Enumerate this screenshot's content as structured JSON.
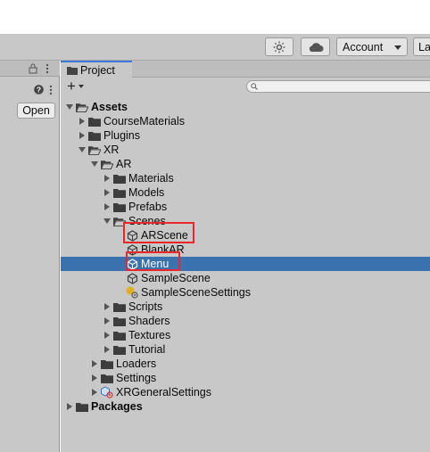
{
  "toolbar": {
    "sun_icon": "lighting-icon",
    "cloud_icon": "cloud-icon",
    "account_label": "Account",
    "layers_label": "La"
  },
  "left_panel": {
    "open_label": "Open"
  },
  "project": {
    "tab_label": "Project",
    "add_label": "+",
    "search_placeholder": ""
  },
  "tree": [
    {
      "label": "Assets",
      "bold": true,
      "expanded": true,
      "icon": "folder-open-icon"
    },
    {
      "label": "CourseMaterials",
      "icon": "folder-icon"
    },
    {
      "label": "Plugins",
      "icon": "folder-icon"
    },
    {
      "label": "XR",
      "expanded": true,
      "icon": "folder-open-icon"
    },
    {
      "label": "AR",
      "expanded": true,
      "icon": "folder-open-icon"
    },
    {
      "label": "Materials",
      "icon": "folder-icon"
    },
    {
      "label": "Models",
      "icon": "folder-icon"
    },
    {
      "label": "Prefabs",
      "icon": "folder-icon"
    },
    {
      "label": "Scenes",
      "expanded": true,
      "icon": "folder-open-icon"
    },
    {
      "label": "ARScene",
      "icon": "unity-scene-icon"
    },
    {
      "label": "BlankAR",
      "icon": "unity-scene-icon"
    },
    {
      "label": "Menu",
      "icon": "unity-scene-icon",
      "selected": true
    },
    {
      "label": "SampleScene",
      "icon": "unity-scene-icon"
    },
    {
      "label": "SampleSceneSettings",
      "icon": "lighting-settings-icon"
    },
    {
      "label": "Scripts",
      "icon": "folder-icon"
    },
    {
      "label": "Shaders",
      "icon": "folder-icon"
    },
    {
      "label": "Textures",
      "icon": "folder-icon"
    },
    {
      "label": "Tutorial",
      "icon": "folder-icon"
    },
    {
      "label": "Loaders",
      "icon": "folder-icon"
    },
    {
      "label": "Settings",
      "icon": "folder-icon"
    },
    {
      "label": "XRGeneralSettings",
      "icon": "xr-settings-icon"
    },
    {
      "label": "Packages",
      "bold": true,
      "icon": "folder-icon"
    }
  ],
  "colors": {
    "selection": "#3a72b0",
    "highlight_box": "#e8262b",
    "tab_accent": "#3a79d9"
  }
}
